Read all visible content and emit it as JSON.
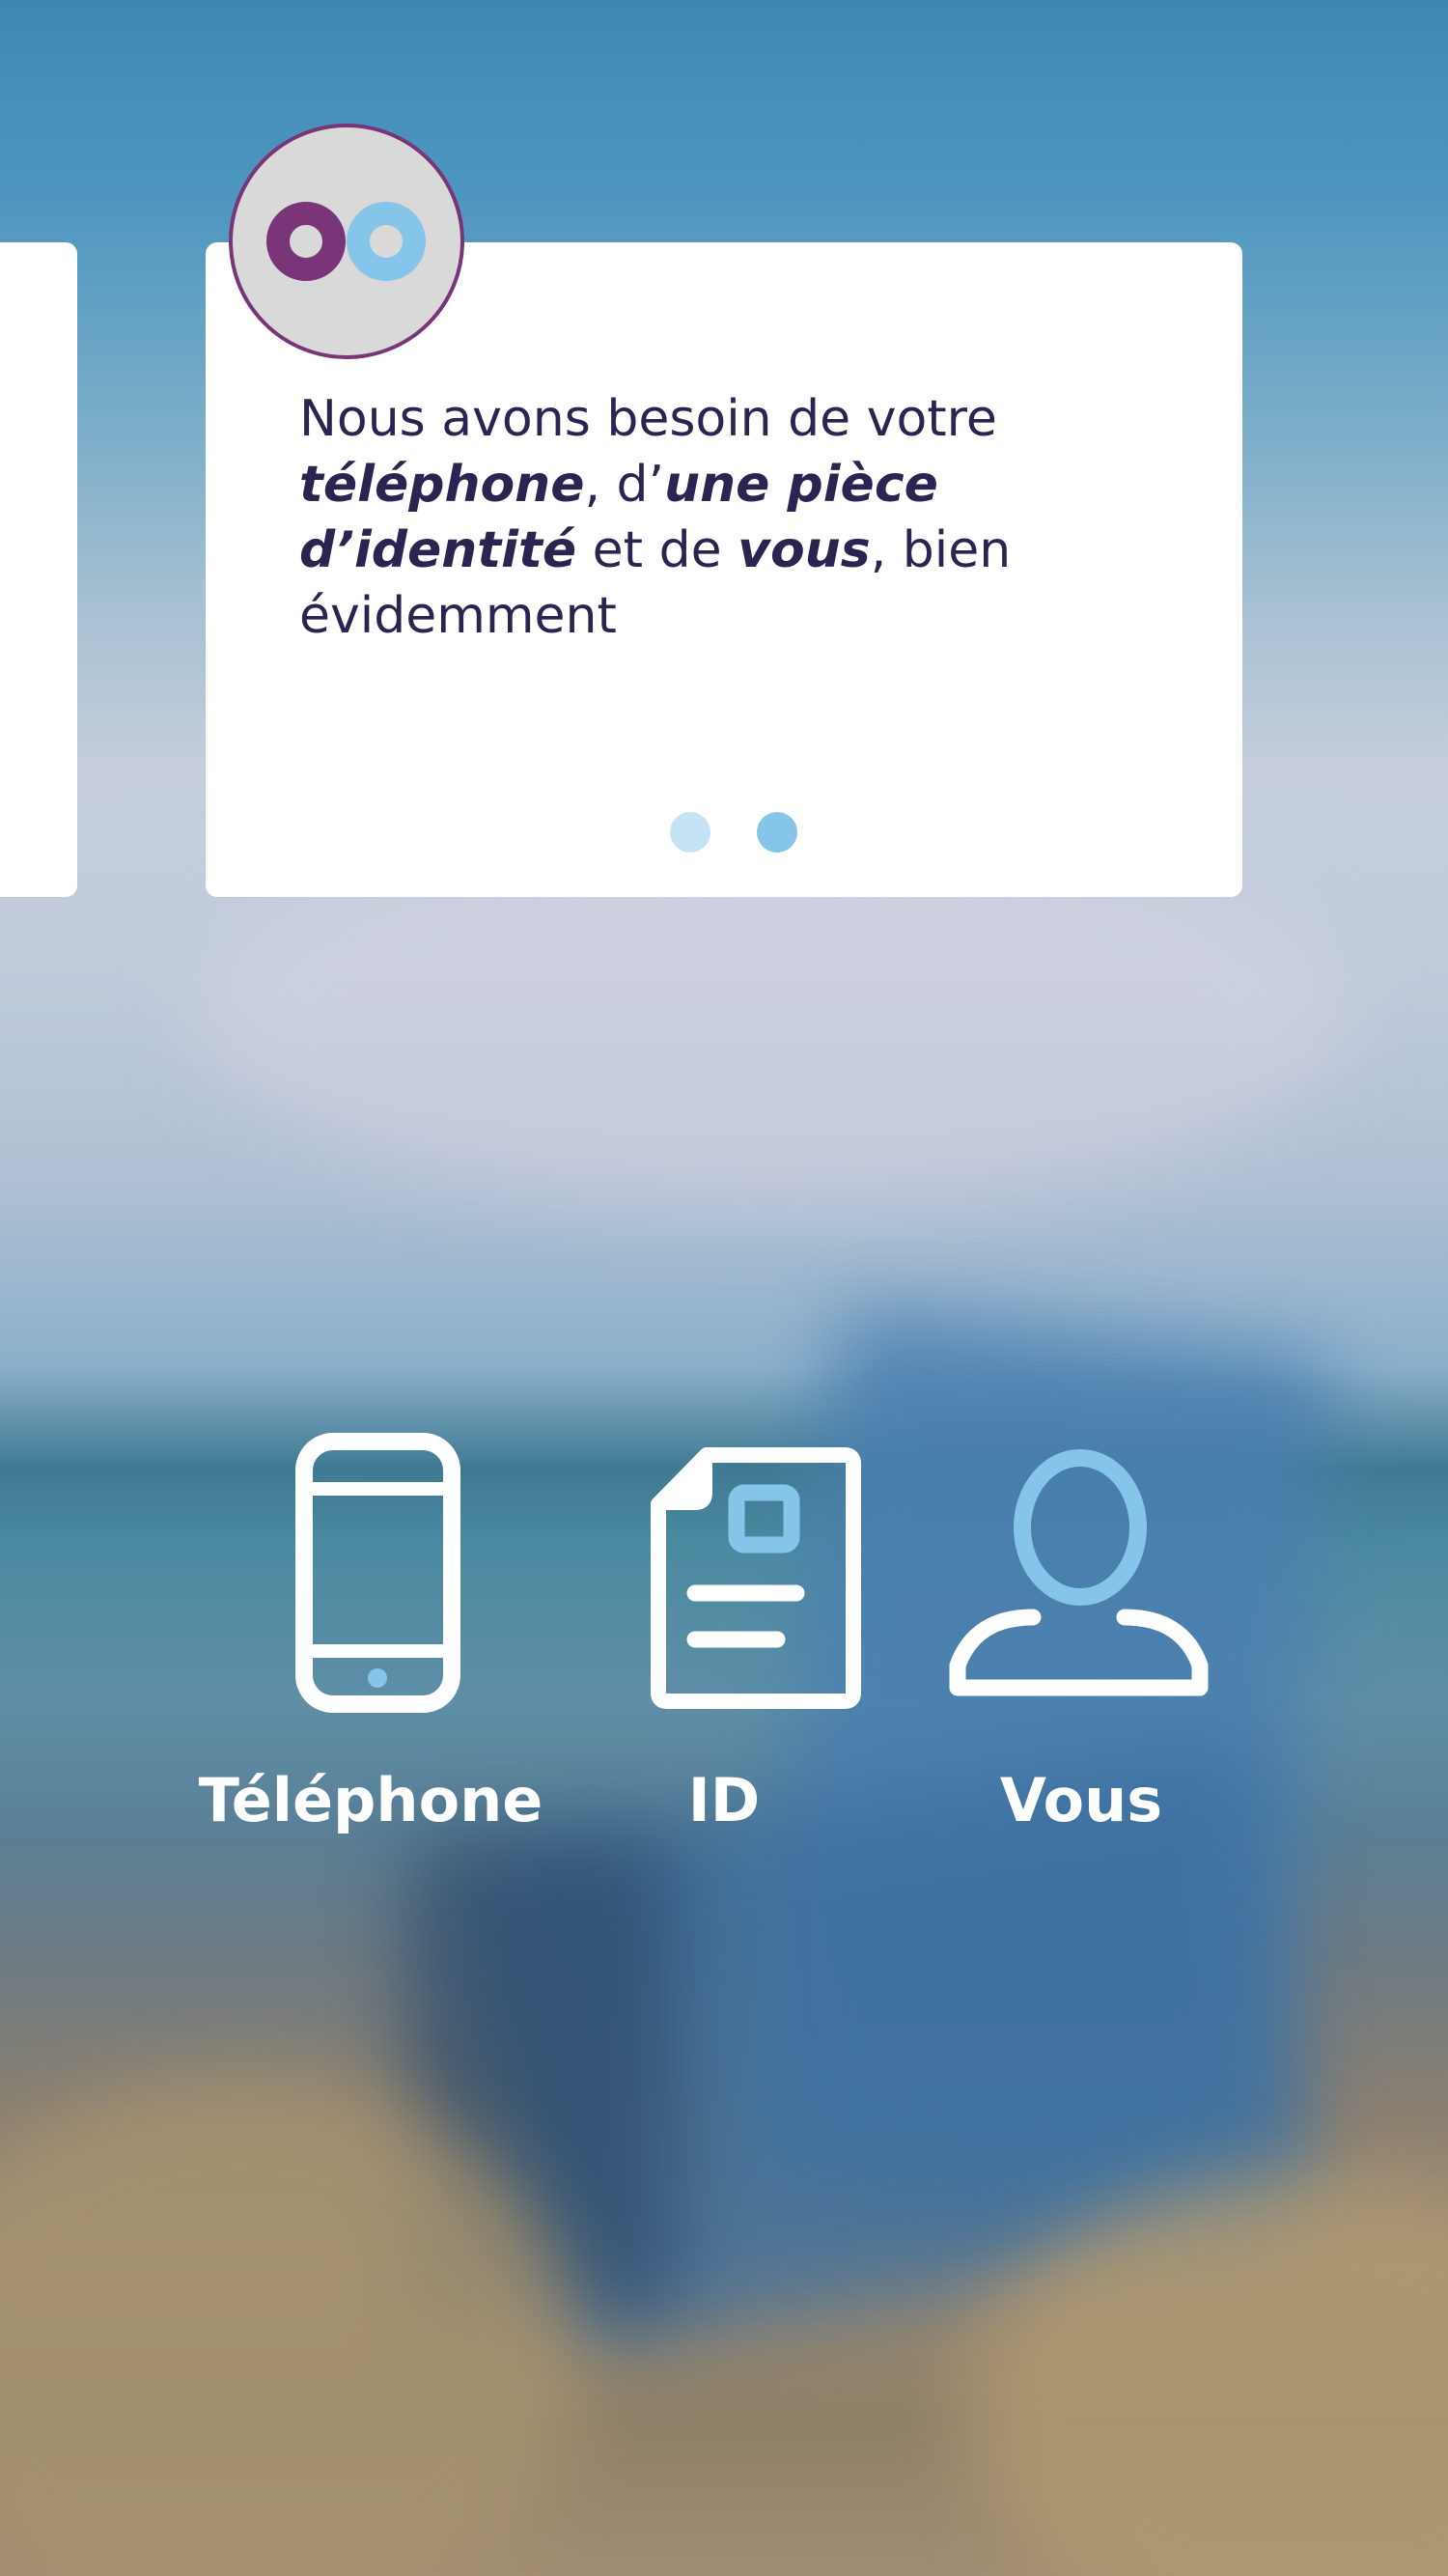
{
  "onboarding_card": {
    "text_segments": [
      {
        "text": "Nous avons besoin de votre ",
        "emphasis": false
      },
      {
        "text": "téléphone",
        "emphasis": true
      },
      {
        "text": ", d’",
        "emphasis": false
      },
      {
        "text": "une pièce d’identité",
        "emphasis": true
      },
      {
        "text": " et de ",
        "emphasis": false
      },
      {
        "text": "vous",
        "emphasis": true
      },
      {
        "text": ", bien évidemment",
        "emphasis": false
      }
    ],
    "pagination": {
      "total": 2,
      "active_index": 1
    }
  },
  "logo": {
    "icon": "logo-two-circles-icon"
  },
  "features": [
    {
      "label": "Téléphone",
      "icon": "phone-icon"
    },
    {
      "label": "ID",
      "icon": "id-card-icon"
    },
    {
      "label": "Vous",
      "icon": "person-icon"
    }
  ],
  "colors": {
    "text_dark": "#2b2450",
    "accent_purple": "#7a3478",
    "accent_blue": "#85c5ea",
    "dot_inactive": "#c5e3f5",
    "dot_active": "#85c5ea",
    "icon_white": "#ffffff",
    "avatar_bg": "#d9d9d9"
  }
}
